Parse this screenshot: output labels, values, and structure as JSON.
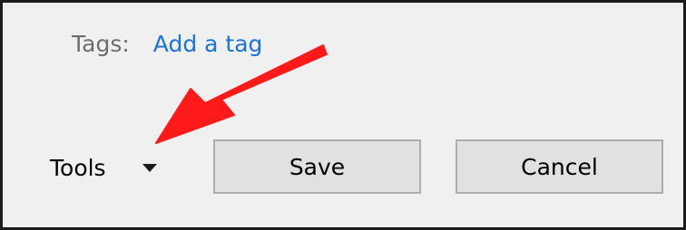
{
  "tags": {
    "label": "Tags:",
    "link_text": "Add a tag"
  },
  "tools": {
    "label": "Tools",
    "icon": "chevron-down-icon"
  },
  "buttons": {
    "save_label": "Save",
    "cancel_label": "Cancel"
  },
  "annotation": {
    "icon": "red-pointer-arrow",
    "color": "#ff1a1a"
  },
  "colors": {
    "link": "#1a73d9",
    "dialog_background": "#f0f0f0",
    "button_background": "#e1e1e1",
    "button_border": "#adadad"
  }
}
